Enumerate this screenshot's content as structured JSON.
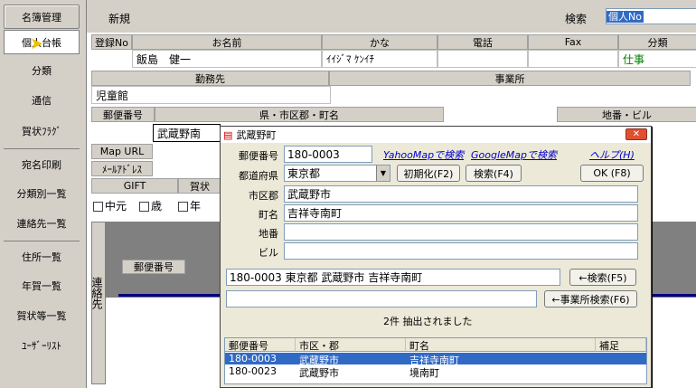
{
  "sidebar": {
    "items": [
      "名簿管理",
      "個人台帳",
      "分類",
      "通信",
      "賀状ﾌﾗｸﾞ",
      "宛名印刷",
      "分類別一覧",
      "連絡先一覧",
      "住所一覧",
      "年賀一覧",
      "賀状等一覧",
      "ﾕｰｻﾞｰﾘｽﾄ"
    ]
  },
  "top": {
    "new_label": "新規",
    "search_label": "検索",
    "search_value": "個人No"
  },
  "table1": {
    "headers": [
      "登録No",
      "お名前",
      "かな",
      "電話",
      "Fax",
      "分類"
    ],
    "row": [
      "",
      "飯島　健一",
      "ｲｲｼﾞﾏ ｹﾝｲﾁ",
      "",
      "",
      "仕事"
    ]
  },
  "table2": {
    "headers": [
      "勤務先",
      "事業所"
    ],
    "row": "児童館"
  },
  "table3": {
    "headers": [
      "郵便番号",
      "県・市区郡・町名",
      "地番・ビル"
    ],
    "row_city": "武蔵野南"
  },
  "labels": {
    "map_url": "Map URL",
    "mail": "ﾒｰﾙｱﾄﾞﾚｽ",
    "gift": "GIFT",
    "nenga": "賀状",
    "chugen": "中元",
    "seibo": "歳",
    "nen": "年",
    "renraku": "連絡先",
    "yubin": "郵便番号"
  },
  "dialog": {
    "title": "武蔵野町",
    "zip_label": "郵便番号",
    "zip_value": "180-0003",
    "yahoo": "YahooMapで検索",
    "google": "GoogleMapで検索",
    "help": "ヘルプ(H)",
    "pref_label": "都道府県",
    "pref_value": "東京都",
    "init_btn": "初期化(F2)",
    "search_btn": "検索(F4)",
    "ok_btn": "OK (F8)",
    "city_label": "市区郡",
    "city_value": "武蔵野市",
    "town_label": "町名",
    "town_value": "吉祥寺南町",
    "chiban_label": "地番",
    "chiban_value": "",
    "bldg_label": "ビル",
    "bldg_value": "",
    "addr_zip": "180-0003",
    "addr_full": "東京都 武蔵野市 吉祥寺南町",
    "search_addr_btn": "←検索(F5)",
    "search_office_btn": "←事業所検索(F6)",
    "result_text": "2件 抽出されました",
    "grid_headers": [
      "郵便番号",
      "市区・郡",
      "町名",
      "補足"
    ],
    "rows": [
      [
        "180-0003",
        "武蔵野市",
        "吉祥寺南町",
        ""
      ],
      [
        "180-0023",
        "武蔵野市",
        "境南町",
        ""
      ]
    ]
  }
}
